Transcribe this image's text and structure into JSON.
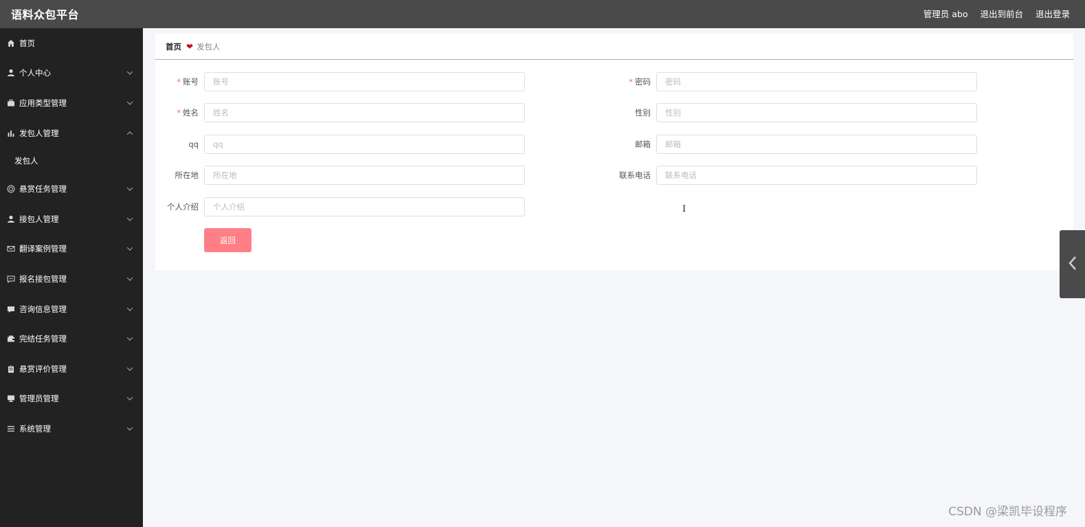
{
  "app": {
    "title": "语料众包平台",
    "user_label": "管理员 abo",
    "to_front_label": "退出到前台",
    "logout_label": "退出登录"
  },
  "sidebar": {
    "items": [
      {
        "label": "首页",
        "icon": "home-icon"
      },
      {
        "label": "个人中心",
        "icon": "user-icon"
      },
      {
        "label": "应用类型管理",
        "icon": "briefcase-icon"
      },
      {
        "label": "发包人管理",
        "icon": "bar-chart-icon",
        "expanded": true,
        "children": [
          "发包人"
        ]
      },
      {
        "label": "悬赏任务管理",
        "icon": "target-icon"
      },
      {
        "label": "接包人管理",
        "icon": "user-icon"
      },
      {
        "label": "翻译案例管理",
        "icon": "mail-icon"
      },
      {
        "label": "报名接包管理",
        "icon": "chat-icon"
      },
      {
        "label": "咨询信息管理",
        "icon": "message-icon"
      },
      {
        "label": "完结任务管理",
        "icon": "wallet-icon"
      },
      {
        "label": "悬赏评价管理",
        "icon": "clipboard-icon"
      },
      {
        "label": "管理员管理",
        "icon": "monitor-icon"
      },
      {
        "label": "系统管理",
        "icon": "list-icon"
      }
    ]
  },
  "breadcrumb": {
    "home": "首页",
    "current": "发包人"
  },
  "form": {
    "account": {
      "label": "账号",
      "placeholder": "账号",
      "value": "",
      "required": true
    },
    "password": {
      "label": "密码",
      "placeholder": "密码",
      "value": "",
      "required": true
    },
    "name": {
      "label": "姓名",
      "placeholder": "姓名",
      "value": "",
      "required": true
    },
    "gender": {
      "label": "性别",
      "placeholder": "性别",
      "value": ""
    },
    "qq": {
      "label": "qq",
      "placeholder": "qq",
      "value": ""
    },
    "email": {
      "label": "邮箱",
      "placeholder": "邮箱",
      "value": ""
    },
    "location": {
      "label": "所在地",
      "placeholder": "所在地",
      "value": ""
    },
    "phone": {
      "label": "联系电话",
      "placeholder": "联系电话",
      "value": ""
    },
    "intro": {
      "label": "个人介绍",
      "placeholder": "个人介绍",
      "value": ""
    },
    "back_label": "返回"
  },
  "watermark": "CSDN @梁凯毕设程序",
  "colors": {
    "topbar": "#4a4a4a",
    "sidebar": "#222222",
    "button": "#ff7f86",
    "required": "#f56c6c",
    "heart": "#c0141b"
  }
}
